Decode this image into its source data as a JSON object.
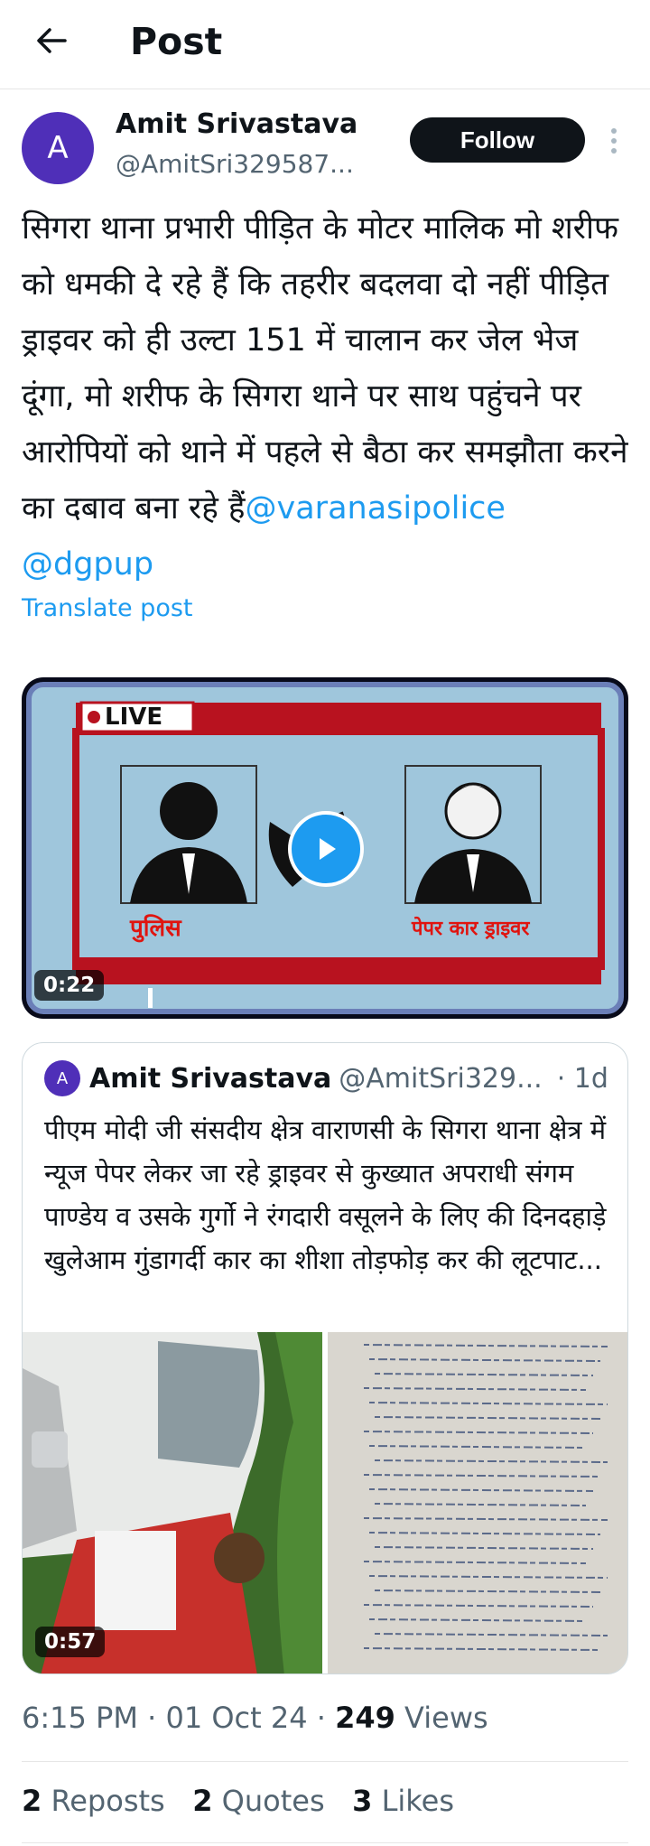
{
  "header": {
    "title": "Post",
    "back_icon": "arrow-left-icon"
  },
  "author": {
    "avatar_letter": "A",
    "avatar_color": "#4f2fb8",
    "name": "Amit Srivastava",
    "handle": "@AmitSri329587..."
  },
  "actions": {
    "follow_label": "Follow",
    "more_icon": "more-vertical-icon"
  },
  "post": {
    "text": "सिगरा थाना प्रभारी पीड़ित के मोटर मालिक मो शरीफ को धमकी दे रहे हैं कि तहरीर बदलवा दो नहीं पीड़ित ड्राइवर को ही उल्टा 151 में चालान कर जेल भेज दूंगा, मो शरीफ के सिगरा थाने पर साथ पहुंचने पर आरोपियों को थाने में पहले से बैठा कर समझौता करने का दबाव बना रहे हैं",
    "mention1": "@varanasipolice",
    "mention2": "@dgpup",
    "translate": "Translate post"
  },
  "video": {
    "live_label": "LIVE",
    "left_caption": "पुलिस",
    "right_caption": "पेपर कार ड्राइवर",
    "duration": "0:22"
  },
  "quote": {
    "avatar_letter": "A",
    "name": "Amit Srivastava",
    "handle": "@AmitSri329...",
    "time": "· 1d",
    "text": "पीएम मोदी जी संसदीय क्षेत्र वाराणसी के सिगरा थाना क्षेत्र में न्यूज पेपर लेकर जा रहे ड्राइवर से कुख्यात अपराधी संगम पाण्डेय व उसके गुर्गो ने रंगदारी वसूलने के लिए की दिनदहाड़े खुलेआम गुंडागर्दी कार का शीशा तोड़फोड़ कर की लूटपाट...",
    "video_duration": "0:57"
  },
  "meta": {
    "time": "6:15 PM",
    "date": "01 Oct 24",
    "views_count": "249",
    "views_label": "Views",
    "sep": "·"
  },
  "stats": {
    "reposts_count": "2",
    "reposts_label": "Reposts",
    "quotes_count": "2",
    "quotes_label": "Quotes",
    "likes_count": "3",
    "likes_label": "Likes"
  },
  "colors": {
    "accent": "#1d9bf0",
    "text": "#0f1419",
    "muted": "#536471",
    "live_red": "#b8121f"
  }
}
